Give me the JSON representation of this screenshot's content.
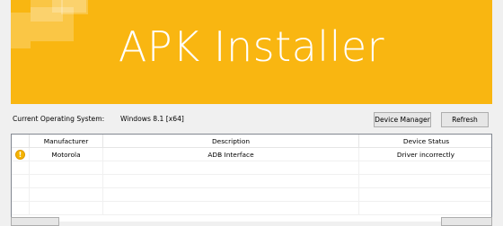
{
  "banner": {
    "title": "APK Installer",
    "color": "#f9b611"
  },
  "system": {
    "os_label": "Current Operating System:",
    "os_value": "Windows 8.1  [x64]"
  },
  "buttons": {
    "device_manager": "Device Manager",
    "refresh": "Refresh"
  },
  "table": {
    "columns": [
      "",
      "Manufacturer",
      "Description",
      "Device Status"
    ],
    "rows": [
      {
        "status_icon": "warning-icon",
        "manufacturer": "Motorola",
        "description": "ADB Interface",
        "status": "Driver incorrectly"
      }
    ]
  },
  "warning_icon_glyph": "!"
}
